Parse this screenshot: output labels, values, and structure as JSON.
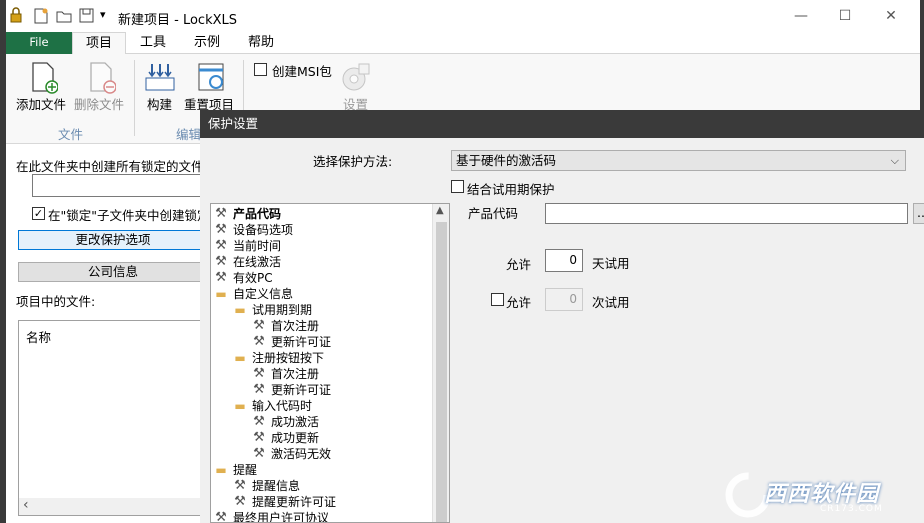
{
  "window": {
    "title": "新建项目 - LockXLS",
    "minimize": "—",
    "maximize": "☐",
    "close": "✕",
    "qa_dropdown": "▾"
  },
  "tabs": [
    "File",
    "项目",
    "工具",
    "示例",
    "帮助"
  ],
  "ribbon": {
    "add_file": "添加文件",
    "remove_file": "删除文件",
    "build": "构建",
    "reset_project": "重置项目",
    "create_msi": "创建MSI包",
    "settings": "设置",
    "group_file": "文件",
    "group_edit": "编辑"
  },
  "left": {
    "folder_label": "在此文件夹中创建所有锁定的文件",
    "folder_value": "",
    "subfolder_checkbox": "在\"锁定\"子文件夹中创建锁定",
    "change_protection": "更改保护选项",
    "company_info": "公司信息",
    "files_label": "项目中的文件:",
    "col_name": "名称",
    "scroll_left": "‹"
  },
  "dialog": {
    "title": "保护设置",
    "method_label": "选择保护方法:",
    "method_value": "基于硬件的激活码",
    "combine_trial": "结合试用期保护",
    "product_code_label": "产品代码",
    "product_code_value": "",
    "browse": "...",
    "allow_label": "允许",
    "trial_days_value": "0",
    "trial_days_unit": "天试用",
    "allow2_label": "允许",
    "trial_runs_value": "0",
    "trial_runs_unit": "次试用"
  },
  "tree": [
    {
      "label": "产品代码",
      "icon": "wrench-icon",
      "level": 0,
      "bold": true
    },
    {
      "label": "设备码选项",
      "icon": "wrench-icon",
      "level": 0
    },
    {
      "label": "当前时间",
      "icon": "wrench-icon",
      "level": 0
    },
    {
      "label": "在线激活",
      "icon": "wrench-icon",
      "level": 0
    },
    {
      "label": "有效PC",
      "icon": "wrench-icon",
      "level": 0
    },
    {
      "label": "自定义信息",
      "icon": "folder-icon",
      "level": 0
    },
    {
      "label": "试用期到期",
      "icon": "folder-icon",
      "level": 1
    },
    {
      "label": "首次注册",
      "icon": "wrench-icon",
      "level": 2
    },
    {
      "label": "更新许可证",
      "icon": "wrench-icon",
      "level": 2
    },
    {
      "label": "注册按钮按下",
      "icon": "folder-icon",
      "level": 1
    },
    {
      "label": "首次注册",
      "icon": "wrench-icon",
      "level": 2
    },
    {
      "label": "更新许可证",
      "icon": "wrench-icon",
      "level": 2
    },
    {
      "label": "输入代码时",
      "icon": "folder-icon",
      "level": 1
    },
    {
      "label": "成功激活",
      "icon": "wrench-icon",
      "level": 2
    },
    {
      "label": "成功更新",
      "icon": "wrench-icon",
      "level": 2
    },
    {
      "label": "激活码无效",
      "icon": "wrench-icon",
      "level": 2
    },
    {
      "label": "提醒",
      "icon": "folder-icon",
      "level": 0
    },
    {
      "label": "提醒信息",
      "icon": "wrench-icon",
      "level": 1
    },
    {
      "label": "提醒更新许可证",
      "icon": "wrench-icon",
      "level": 1
    },
    {
      "label": "最终用户许可协议",
      "icon": "wrench-icon",
      "level": 0
    }
  ],
  "watermark": {
    "brand": "西西软件园",
    "url": "CR173.COM"
  },
  "colors": {
    "file_tab": "#1e7145",
    "dialog_title": "#3a3a3a",
    "ribbon_group_text": "#6a8bb0"
  }
}
